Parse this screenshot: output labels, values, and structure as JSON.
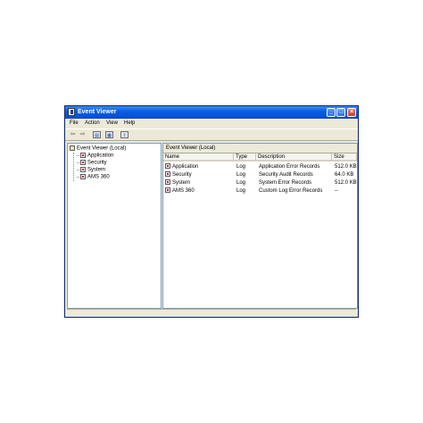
{
  "window": {
    "title": "Event Viewer"
  },
  "menu": [
    {
      "label": "File"
    },
    {
      "label": "Action"
    },
    {
      "label": "View"
    },
    {
      "label": "Help"
    }
  ],
  "toolbar": {
    "back_glyph": "⇦",
    "forward_glyph": "⇨"
  },
  "tree": {
    "root": "Event Viewer (Local)",
    "items": [
      {
        "label": "Application"
      },
      {
        "label": "Security"
      },
      {
        "label": "System"
      },
      {
        "label": "AMS 360"
      }
    ]
  },
  "list": {
    "header": "Event Viewer (Local)",
    "columns": [
      {
        "label": "Name"
      },
      {
        "label": "Type"
      },
      {
        "label": "Description"
      },
      {
        "label": "Size"
      }
    ],
    "rows": [
      {
        "name": "Application",
        "type": "Log",
        "description": "Application Error Records",
        "size": "512.0 KB"
      },
      {
        "name": "Security",
        "type": "Log",
        "description": "Security Audit Records",
        "size": "64.0 KB"
      },
      {
        "name": "System",
        "type": "Log",
        "description": "System Error Records",
        "size": "512.0 KB"
      },
      {
        "name": "AMS 360",
        "type": "Log",
        "description": "Custom Log Error Records",
        "size": "--"
      }
    ]
  },
  "colors": {
    "titlebar": "#0653d9",
    "window_bg": "#ece9d8",
    "pane_border": "#7f9db9"
  }
}
